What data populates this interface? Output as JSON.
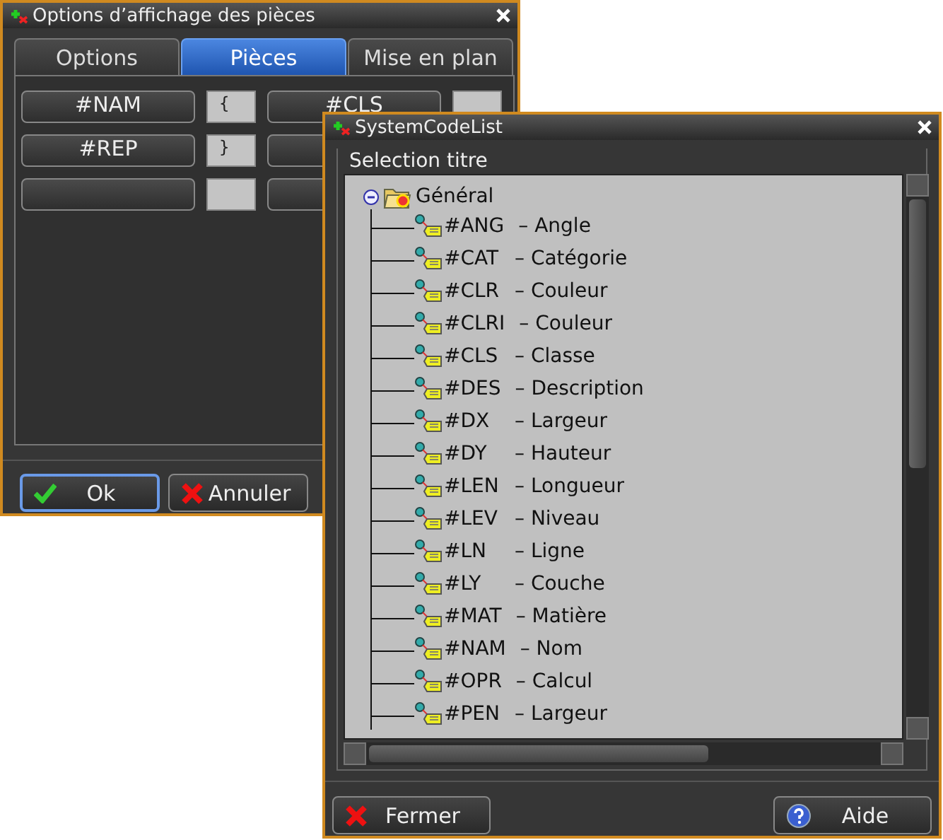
{
  "options_window": {
    "title": "Options d’affichage des pièces",
    "tabs": [
      {
        "label": "Options",
        "selected": false
      },
      {
        "label": "Pièces",
        "selected": true
      },
      {
        "label": "Mise en plan",
        "selected": false
      }
    ],
    "rows": [
      {
        "code": "#NAM",
        "open": "{",
        "code_2": "#CLS",
        "field_2_shown": true
      },
      {
        "code": "#REP",
        "open": "}",
        "field_2_shown": false
      },
      {
        "field_2_shown": false
      }
    ],
    "buttons": [
      {
        "label": "Ok",
        "kind": "ok",
        "focused": true
      },
      {
        "label": "Annuler",
        "kind": "cancel",
        "focused": false
      }
    ]
  },
  "code_list_window": {
    "title": "SystemCodeList",
    "group_title": "Selection titre",
    "tree": {
      "label": "Général",
      "expanded": true,
      "children": [
        {
          "code": "#ANG",
          "description": "– Angle"
        },
        {
          "code": "#CAT",
          "description": "– Catégorie"
        },
        {
          "code": "#CLR",
          "description": "– Couleur"
        },
        {
          "code": "#CLRI",
          "description": "– Couleur"
        },
        {
          "code": "#CLS",
          "description": "– Classe"
        },
        {
          "code": "#DES",
          "description": "– Description"
        },
        {
          "code": "#DX",
          "description": "– Largeur"
        },
        {
          "code": "#DY",
          "description": "– Hauteur"
        },
        {
          "code": "#LEN",
          "description": "– Longueur"
        },
        {
          "code": "#LEV",
          "description": "– Niveau"
        },
        {
          "code": "#LN",
          "description": "– Ligne"
        },
        {
          "code": "#LY",
          "description": "– Couche"
        },
        {
          "code": "#MAT",
          "description": "– Matière"
        },
        {
          "code": "#NAM",
          "description": "– Nom"
        },
        {
          "code": "#OPR",
          "description": "– Calcul"
        },
        {
          "code": "#PEN",
          "description": "– Largeur"
        }
      ]
    },
    "buttons": [
      {
        "label": "Fermer",
        "kind": "close"
      },
      {
        "label": "Aide",
        "kind": "help"
      }
    ]
  }
}
